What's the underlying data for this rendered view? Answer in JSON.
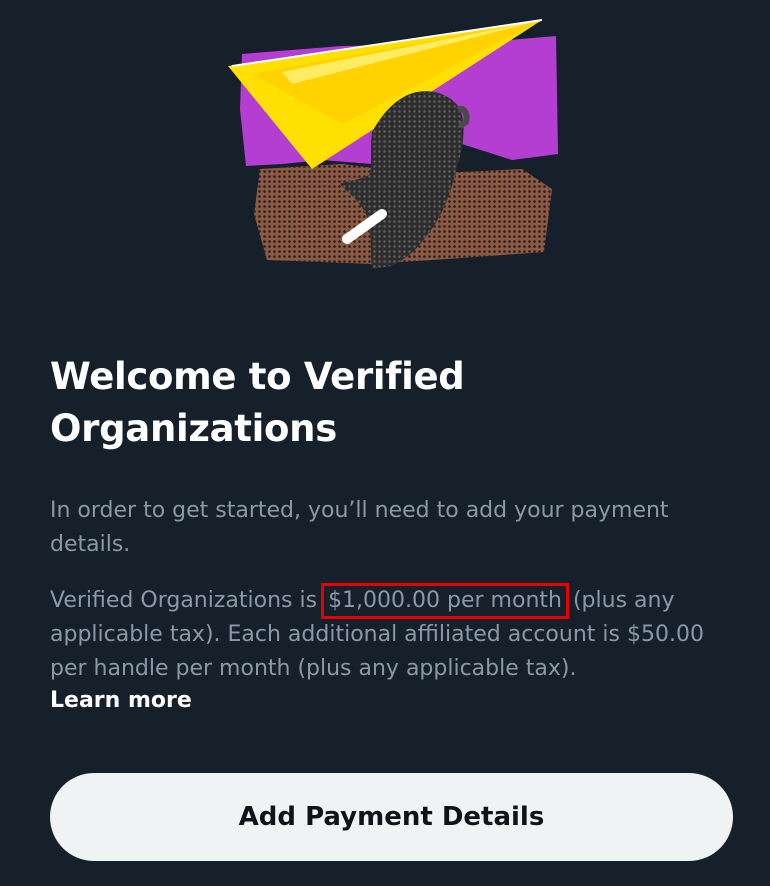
{
  "illustration": {
    "description_icon": "paper-plane-hand-illustration",
    "colors": {
      "purple": "#a530c7",
      "yellow": "#ffe600",
      "brown": "#6b4a3a",
      "hand": "#2a2a2a"
    }
  },
  "heading": {
    "line1": "Welcome to Verified",
    "line2": "Organizations"
  },
  "intro": "In order to get started, you’ll need to add your payment details.",
  "pricing": {
    "prefix": "Verified Organizations is ",
    "price": "$1,000.00 per month",
    "suffix": " (plus any applicable tax). Each additional affiliated account is $50.00 per handle per month (plus any applicable tax)."
  },
  "learn_more": "Learn more",
  "cta": {
    "label": "Add Payment Details"
  },
  "theme": {
    "background": "#15202b",
    "text_secondary": "#8b98a5",
    "button_bg": "#eff3f4",
    "highlight_border": "#e60000"
  }
}
